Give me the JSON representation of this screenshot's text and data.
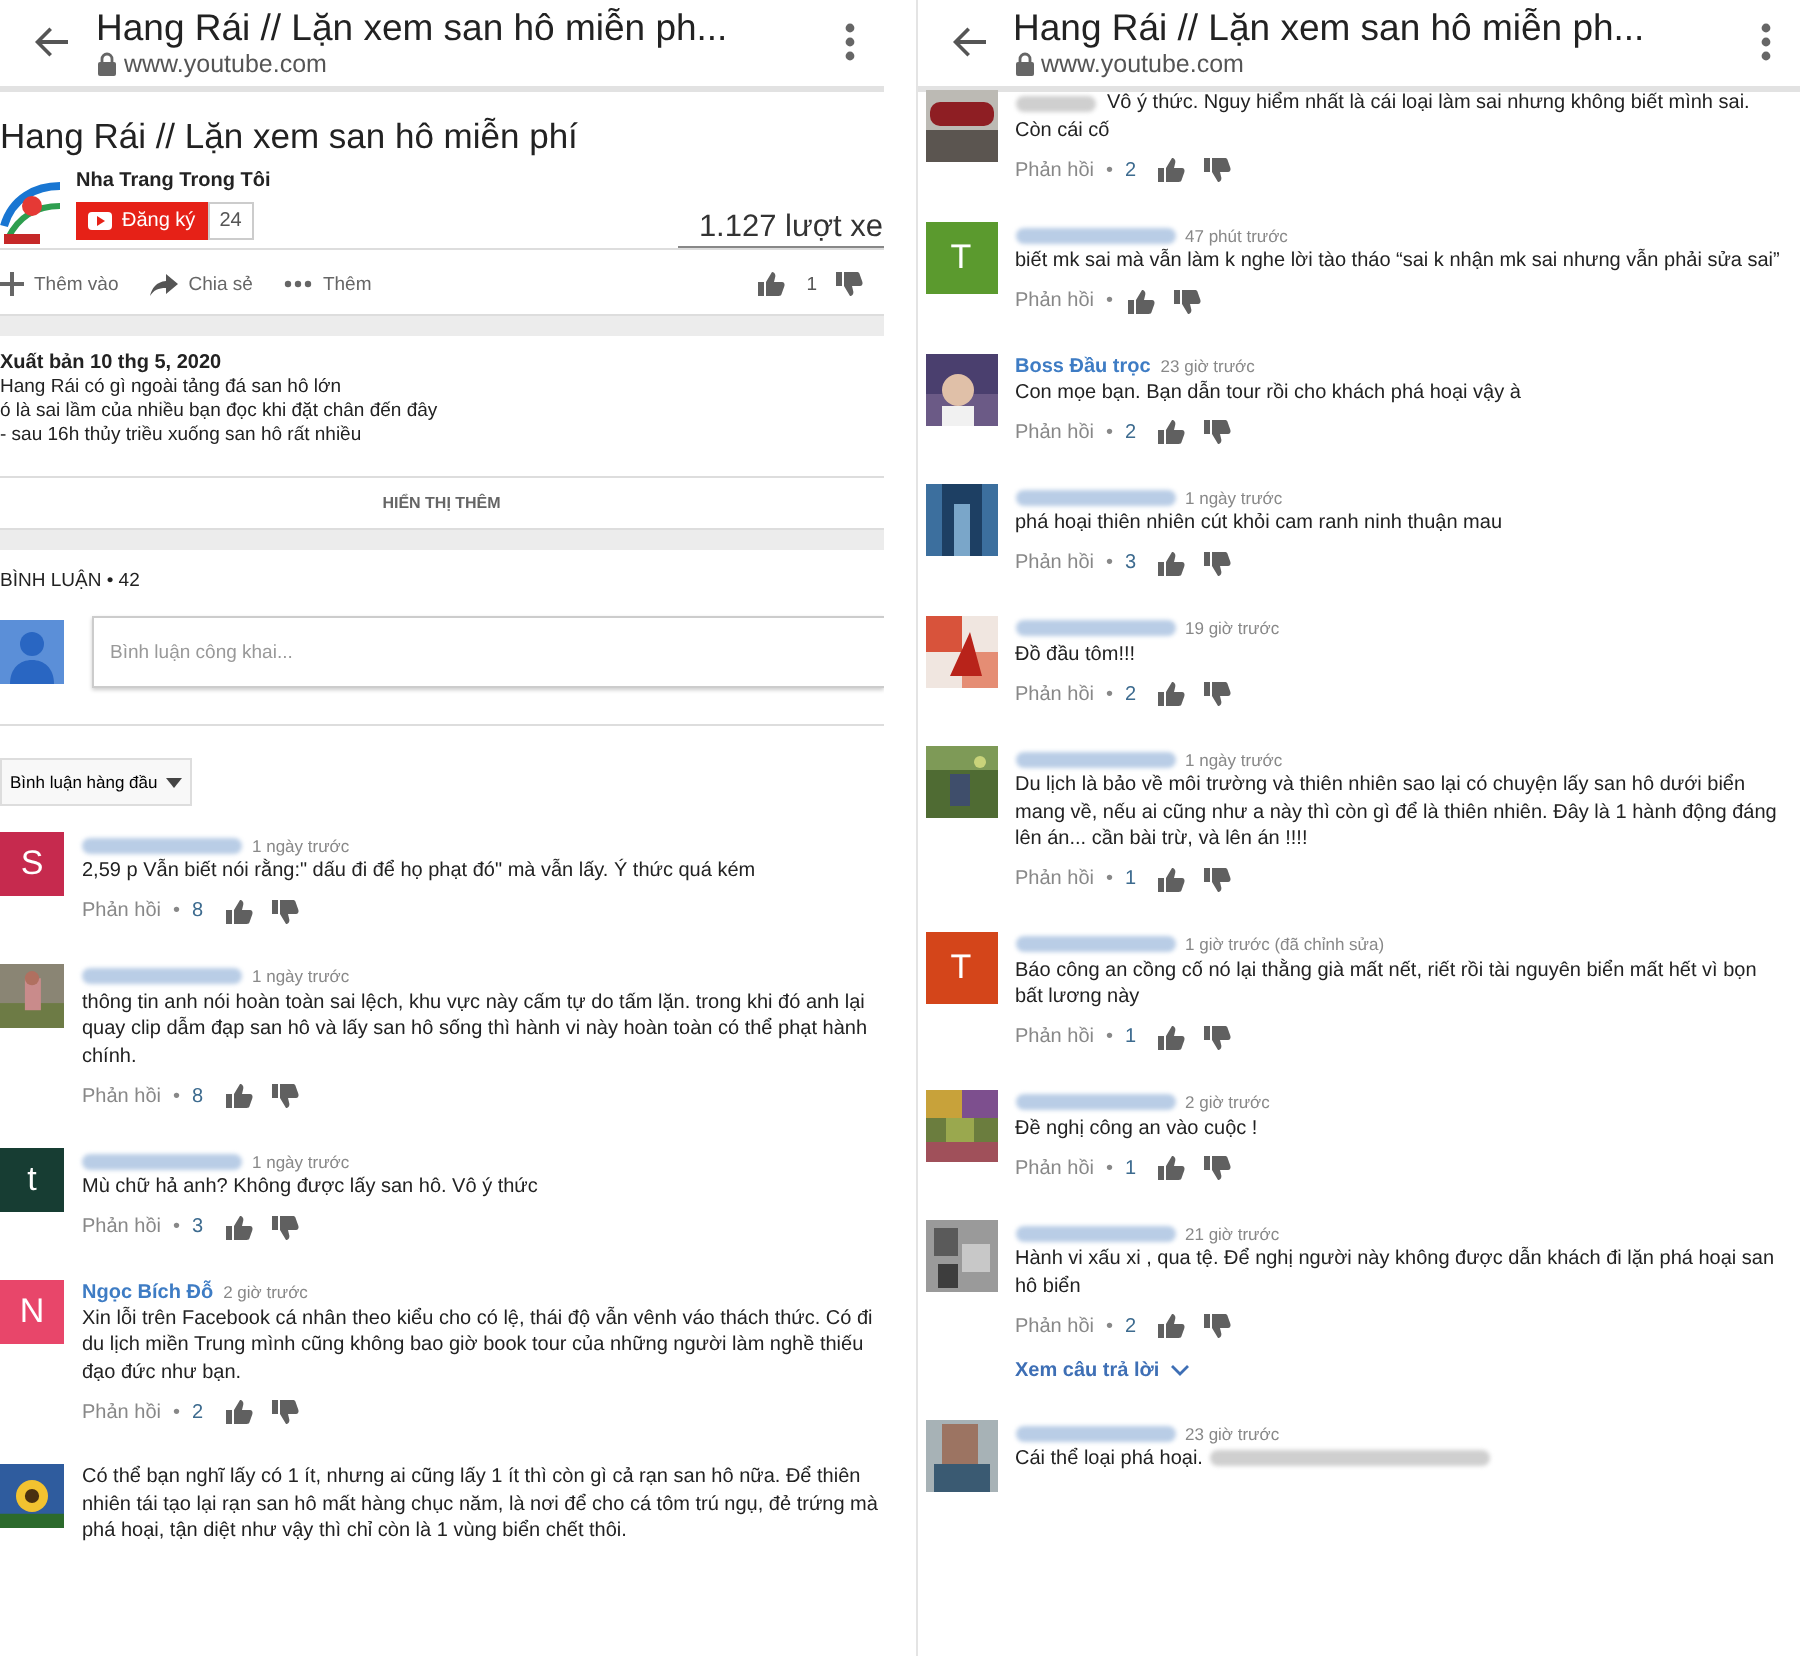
{
  "panels": [
    {
      "header": {
        "title": "Hang Rái // Lặn xem san hô miễn ph...",
        "url": "www.youtube.com"
      },
      "video": {
        "title": "Hang Rái // Lặn xem san hô miễn phí",
        "channel": "Nha Trang Trong Tôi",
        "subscribe": "Đăng ký",
        "subscribers": "24",
        "views": "1.127 lượt xe",
        "actions": [
          {
            "kind": "add",
            "label": "Thêm vào"
          },
          {
            "kind": "share",
            "label": "Chia sẻ"
          },
          {
            "kind": "more",
            "label": "Thêm"
          }
        ],
        "likes": "1",
        "published": "Xuất bản 10 thg 5, 2020",
        "description": [
          "Hang Rái có gì ngoài tảng đá san hô lớn",
          "ó là sai lầm của nhiều bạn đọc khi đặt chân đến đây",
          "- sau 16h thủy triều xuống san hô rất nhiều"
        ],
        "show_more": "HIỂN THỊ THÊM"
      },
      "comments_header": {
        "label": "BÌNH LUẬN • 42",
        "placeholder": "Bình luận công khai...",
        "sort": "Bình luận hàng đầu"
      },
      "comments": [
        {
          "avatar": {
            "kind": "letter",
            "letter": "S",
            "color": "#c62a4e"
          },
          "time": "1 ngày trước",
          "text": "2,59 p Vẫn biết nói rằng:\" dấu đi để họ phạt đó\" mà vẫn lấy.  Ý thức quá kém",
          "reply": "Phản hồi",
          "separator": "•",
          "likes": "8"
        },
        {
          "time": "1 ngày trước",
          "text": "thông tin anh nói hoàn toàn sai lệch, khu vực này cấm tự do tấm lặn. trong khi đó anh lại quay clip dẫm đạp san hô và lấy san hô sống thì hành vi này hoàn toàn có thể phạt hành chính.",
          "reply": "Phản hồi",
          "separator": "•",
          "likes": "8"
        },
        {
          "avatar": {
            "kind": "letter",
            "letter": "t",
            "color": "#173d33"
          },
          "time": "1 ngày trước",
          "text": "Mù chữ hả anh? Không được lấy san hô. Vô ý thức",
          "reply": "Phản hồi",
          "separator": "•",
          "likes": "3"
        },
        {
          "avatar": {
            "kind": "letter",
            "letter": "N",
            "color": "#e8466a"
          },
          "author": "Ngọc Bích Đỗ",
          "time": "2 giờ trước",
          "text": "Xin lỗi trên Facebook cá nhân theo kiểu cho có lệ, thái độ vẫn vênh váo thách thức. Có đi du lịch miền Trung mình cũng không bao giờ book tour của những người làm nghề thiếu đạo đức như bạn.",
          "reply": "Phản hồi",
          "separator": "•",
          "likes": "2"
        },
        {
          "text": "Có thể bạn nghĩ lấy có 1 ít, nhưng ai cũng lấy 1 ít thì còn gì cả rạn san hô nữa. Để thiên nhiên tái tạo lại rạn san hô mất hàng chục năm, là nơi để cho cá tôm trú ngụ, đẻ trứng mà phá hoại, tận diệt như vậy thì chỉ còn là 1 vùng biển chết thôi."
        }
      ]
    },
    {
      "header": {
        "title": "Hang Rái // Lặn xem san hô miễn ph...",
        "url": "www.youtube.com"
      },
      "comments": [
        {
          "cut_top": true,
          "blur_before": true,
          "text": "Vô ý thức. Nguy hiểm nhất là cái loại làm sai nhưng không biết mình sai. Còn cái cố",
          "reply": "Phản hồi",
          "separator": "•",
          "likes": "2"
        },
        {
          "avatar": {
            "kind": "letter",
            "letter": "T",
            "color": "#5b9a2e"
          },
          "time": "47 phút trước",
          "text": "biết mk sai mà vẫn làm k nghe lời tào tháo “sai k nhận mk sai nhưng vẫn phải sửa sai”",
          "reply": "Phản hồi",
          "separator": "•"
        },
        {
          "author": "Boss Đầu trọc",
          "time": "23 giờ trước",
          "text": "Con mọe bạn. Bạn dẫn tour rồi cho khách phá hoại vậy à",
          "reply": "Phản hồi",
          "separator": "•",
          "likes": "2"
        },
        {
          "time": "1 ngày trước",
          "text": "phá hoại thiên nhiên cút khỏi cam ranh ninh thuận mau",
          "reply": "Phản hồi",
          "separator": "•",
          "likes": "3"
        },
        {
          "time": "19 giờ trước",
          "text": "Đồ đầu tôm!!!",
          "reply": "Phản hồi",
          "separator": "•",
          "likes": "2"
        },
        {
          "time": "1 ngày trước",
          "text": "Du lịch là bảo về môi trường và thiên nhiên sao lại có chuyện lấy san hô dưới biển mang về, nếu ai cũng như a này thì còn gì để là thiên nhiên. Đây là 1 hành động đáng lên án... cần bài trừ, và lên án !!!!",
          "reply": "Phản hồi",
          "separator": "•",
          "likes": "1"
        },
        {
          "avatar": {
            "kind": "letter",
            "letter": "T",
            "color": "#d4451a"
          },
          "time": "1 giờ trước (đã chỉnh sửa)",
          "text": "Báo công an cồng cố nó lại thằng già mất nết, riết rồi tài nguyên biển mất hết vì bọn bất lương này",
          "reply": "Phản hồi",
          "separator": "•",
          "likes": "1"
        },
        {
          "time": "2 giờ trước",
          "text": "Đề nghị công an vào cuộc !",
          "reply": "Phản hồi",
          "separator": "•",
          "likes": "1"
        },
        {
          "time": "21 giờ trước",
          "text": "Hành vi xấu xi , qua tệ. Để nghị người này không được dẫn khách đi lặn phá hoại san hô biển",
          "reply": "Phản hồi",
          "separator": "•",
          "likes": "2",
          "view_replies": "Xem câu trả lời"
        },
        {
          "time": "23 giờ trước",
          "text": "Cái thể loại phá hoại.",
          "blur_after": true
        }
      ]
    }
  ]
}
